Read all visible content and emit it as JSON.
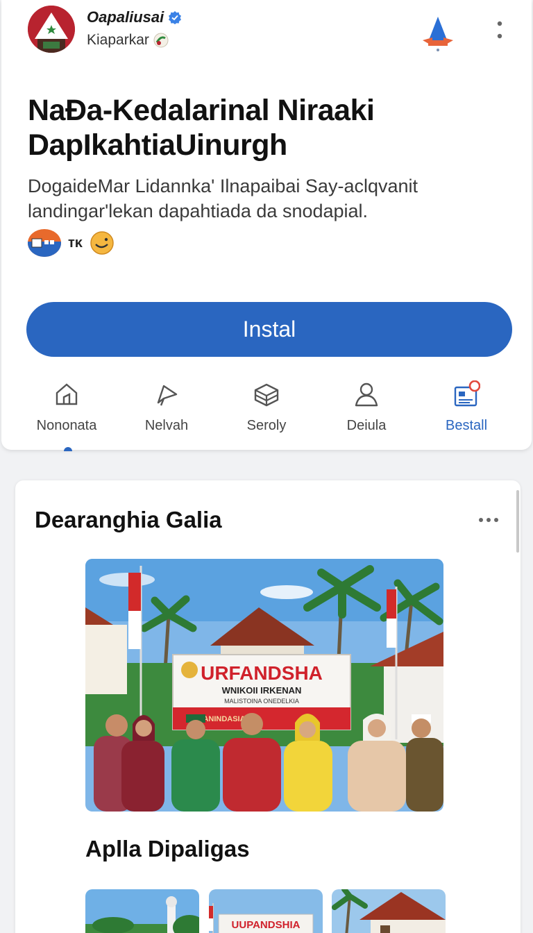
{
  "app": {
    "name": "Oapaliusai",
    "developer": "Kiaparkar"
  },
  "headline": "NaĐa-Kedalarinal Niraaki DapIkahtiaUinurgh",
  "description": "DogaideMar Lidannka' Ilnapaibai Say-aclqvanit landingar'lekan dapahtiada da snodapial.",
  "badge_text": "ᴛᴋ",
  "install_label": "Instal",
  "tabs": [
    {
      "label": "Nononata",
      "icon": "home-icon"
    },
    {
      "label": "Nelvah",
      "icon": "send-icon"
    },
    {
      "label": "Seroly",
      "icon": "box-icon"
    },
    {
      "label": "Deiula",
      "icon": "person-icon"
    },
    {
      "label": "Bestall",
      "icon": "news-icon",
      "active": true
    }
  ],
  "section": {
    "title": "Dearanghia Galia",
    "banner_title": "URFANDSHA",
    "banner_subtitle": "WNIKOII IRKENAN",
    "banner_line": "MALISTOINA ONEDELKIA",
    "banner_footer": "ANINDASIA",
    "subsection_title": "Aplla Dipaligas",
    "thumb_banner": "UUPANDSHIA"
  },
  "colors": {
    "accent": "#2a66c0",
    "logo_red": "#b8232f",
    "notification": "#e2483c"
  }
}
